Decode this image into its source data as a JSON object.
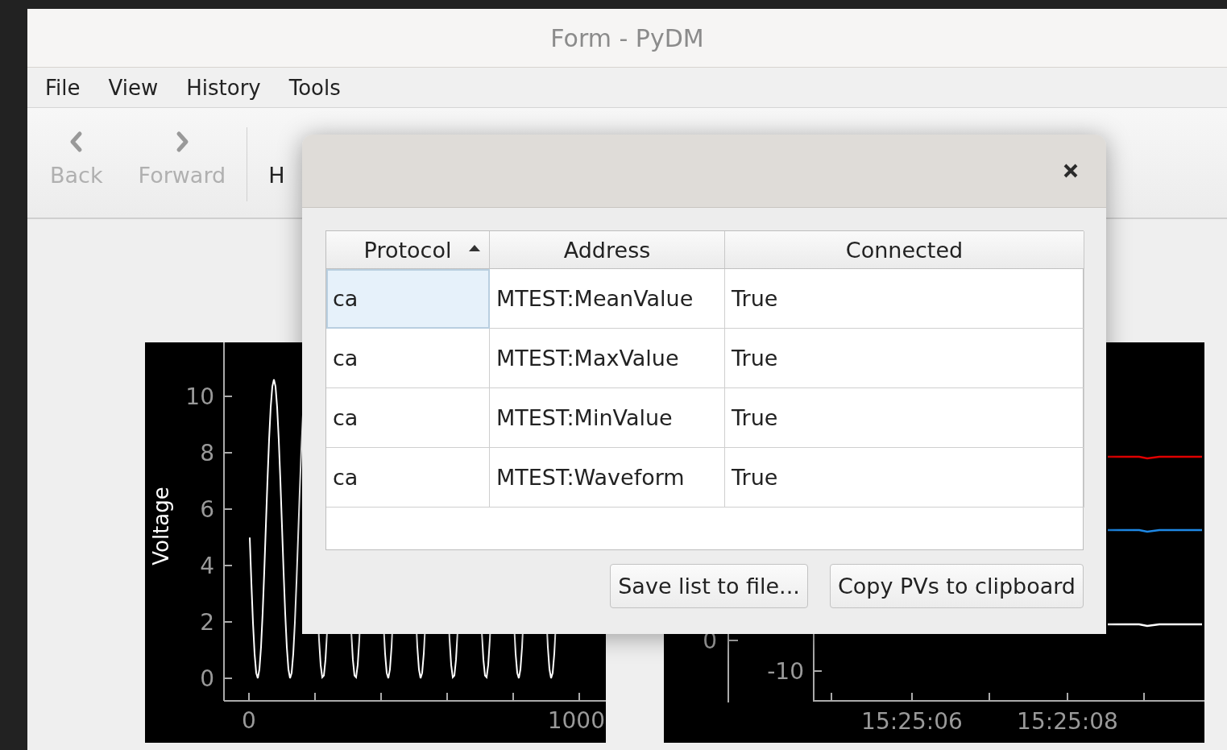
{
  "window": {
    "title": "Form - PyDM"
  },
  "menu": [
    {
      "label": "File"
    },
    {
      "label": "View"
    },
    {
      "label": "History"
    },
    {
      "label": "Tools"
    }
  ],
  "toolbar": [
    {
      "label": "Back",
      "disabled": true
    },
    {
      "label": "Forward",
      "disabled": true
    },
    {
      "label": "H",
      "disabled": false
    }
  ],
  "plots": [
    {
      "kind": "waveform",
      "y_axis_label": "Voltage",
      "y_tick_labels": [
        "10",
        "8",
        "6",
        "4",
        "2",
        "0"
      ],
      "x_tick_labels": [
        "0",
        "1000"
      ]
    },
    {
      "kind": "timeplot",
      "left_axis_tick_labels": [
        "0"
      ],
      "right_axis_tick_labels": [
        "-10"
      ],
      "x_tick_labels": [
        "15:25:06",
        "15:25:08"
      ],
      "traces": [
        {
          "color": "#e00000"
        },
        {
          "color": "#1e88e5"
        },
        {
          "color": "#ffffff"
        }
      ]
    }
  ],
  "dialog": {
    "table": {
      "columns": [
        {
          "label": "Protocol",
          "sorted": true
        },
        {
          "label": "Address",
          "sorted": false
        },
        {
          "label": "Connected",
          "sorted": false
        }
      ],
      "rows": [
        {
          "cells": [
            {
              "text": "ca",
              "selected": true
            },
            {
              "text": "MTEST:MeanValue",
              "selected": false
            },
            {
              "text": "True",
              "selected": false
            }
          ]
        },
        {
          "cells": [
            {
              "text": "ca",
              "selected": false
            },
            {
              "text": "MTEST:MaxValue",
              "selected": false
            },
            {
              "text": "True",
              "selected": false
            }
          ]
        },
        {
          "cells": [
            {
              "text": "ca",
              "selected": false
            },
            {
              "text": "MTEST:MinValue",
              "selected": false
            },
            {
              "text": "True",
              "selected": false
            }
          ]
        },
        {
          "cells": [
            {
              "text": "ca",
              "selected": false
            },
            {
              "text": "MTEST:Waveform",
              "selected": false
            },
            {
              "text": "True",
              "selected": false
            }
          ]
        }
      ]
    },
    "buttons": [
      {
        "label": "Save list to file..."
      },
      {
        "label": "Copy PVs to clipboard"
      }
    ]
  }
}
